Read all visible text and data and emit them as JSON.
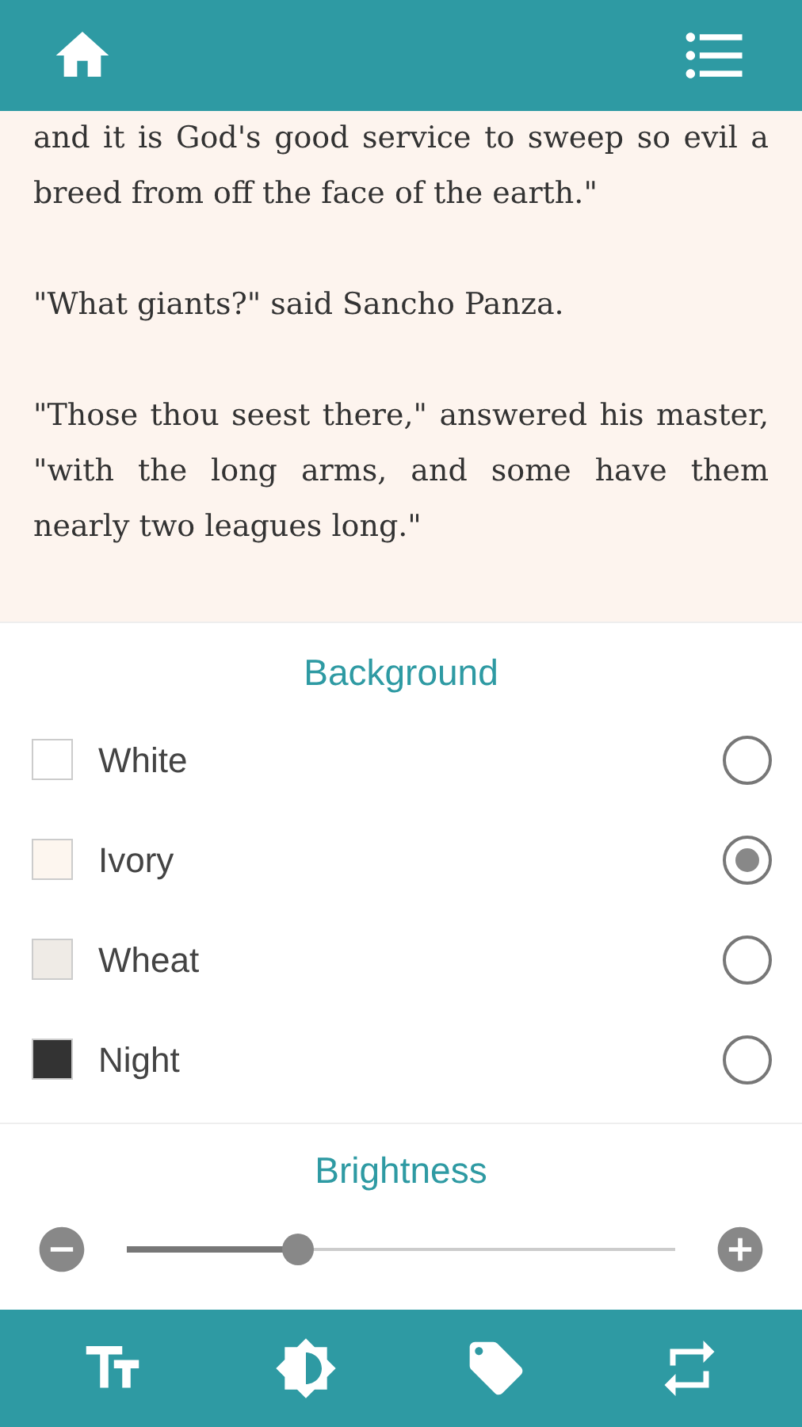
{
  "reader": {
    "paragraphs": [
      "and it is God's good service to sweep so evil a breed from off the face of the earth.\"",
      "\"What giants?\" said Sancho Panza.",
      "\"Those thou seest there,\" answered his master, \"with the long arms, and some have them nearly two leagues long.\""
    ]
  },
  "background": {
    "title": "Background",
    "options": [
      {
        "label": "White",
        "color": "#ffffff",
        "selected": false
      },
      {
        "label": "Ivory",
        "color": "#fdf6ef",
        "selected": true
      },
      {
        "label": "Wheat",
        "color": "#efebe6",
        "selected": false
      },
      {
        "label": "Night",
        "color": "#333333",
        "selected": false
      }
    ]
  },
  "brightness": {
    "title": "Brightness",
    "level": 0.3
  }
}
